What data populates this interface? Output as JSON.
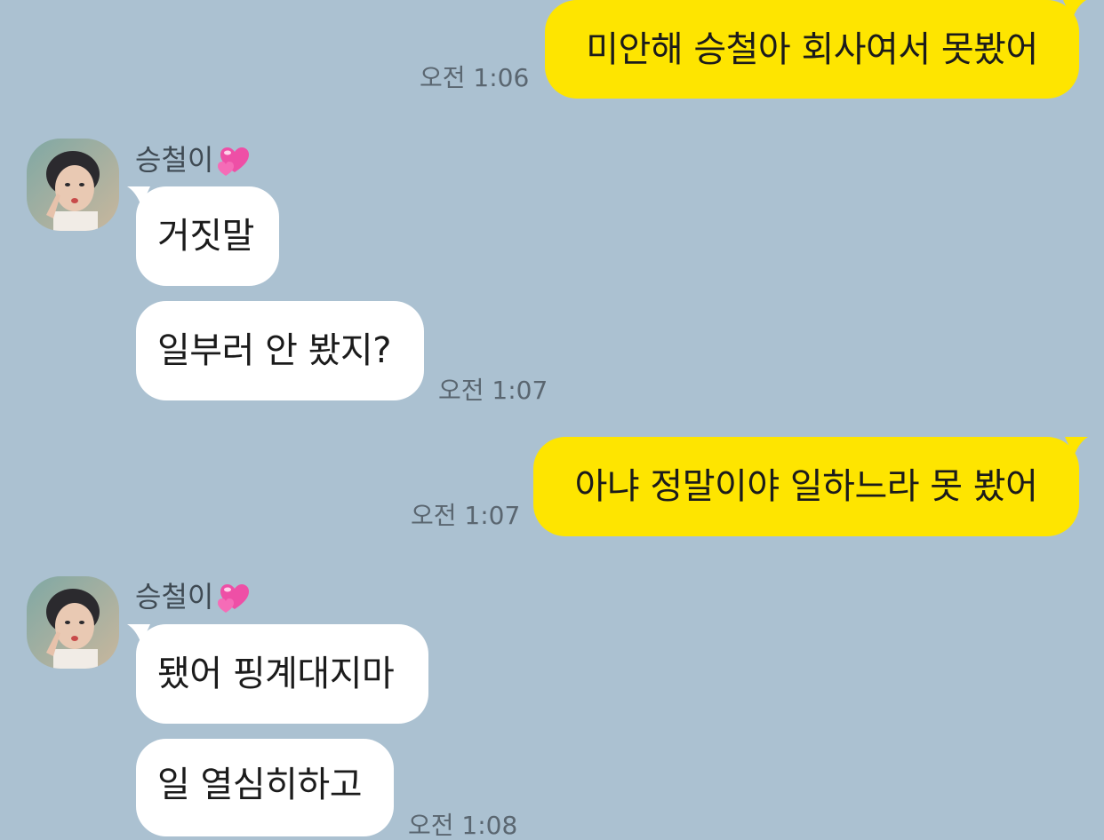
{
  "contact": {
    "name": "승철이",
    "name_icon": "two-hearts-icon"
  },
  "messages": [
    {
      "from": "me",
      "text": "미안해 승철아 회사여서 못봤어",
      "time": "오전 1:06"
    },
    {
      "from": "contact",
      "text": "거짓말",
      "time": ""
    },
    {
      "from": "contact",
      "text": "일부러 안 봤지?",
      "time": "오전 1:07"
    },
    {
      "from": "me",
      "text": "아냐 정말이야 일하느라 못 봤어",
      "time": "오전 1:07"
    },
    {
      "from": "contact",
      "text": "됐어 핑계대지마",
      "time": ""
    },
    {
      "from": "contact",
      "text": "일 열심히하고",
      "time": "오전 1:08"
    }
  ],
  "colors": {
    "background": "#abc1d1",
    "my_bubble": "#fee500",
    "their_bubble": "#ffffff",
    "timestamp": "#5a6670"
  }
}
